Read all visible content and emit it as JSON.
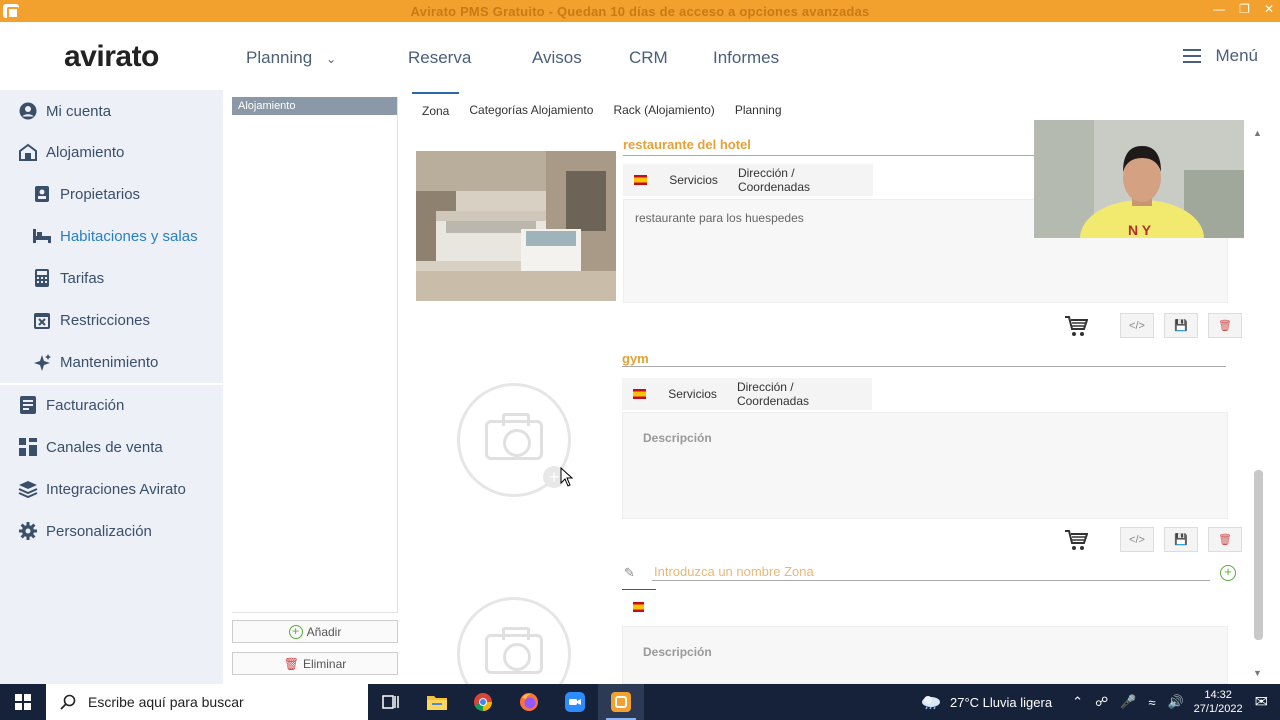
{
  "window": {
    "title": "Avirato PMS Gratuito - Quedan 10 días de acceso a opciones avanzadas"
  },
  "nav": {
    "logo": "avirato",
    "items": [
      "Planning",
      "Reserva",
      "Avisos",
      "CRM",
      "Informes"
    ],
    "menu_label": "Menú"
  },
  "sidebar": {
    "items": [
      {
        "label": "Mi cuenta",
        "icon": "user-icon"
      },
      {
        "label": "Alojamiento",
        "icon": "building-icon"
      },
      {
        "label": "Propietarios",
        "icon": "id-card-icon"
      },
      {
        "label": "Habitaciones y salas",
        "icon": "bed-icon",
        "active": true
      },
      {
        "label": "Tarifas",
        "icon": "calculator-icon"
      },
      {
        "label": "Restricciones",
        "icon": "calendar-x-icon"
      },
      {
        "label": "Mantenimiento",
        "icon": "sparkle-icon"
      },
      {
        "label": "Facturación",
        "icon": "invoice-icon"
      },
      {
        "label": "Canales de venta",
        "icon": "channels-icon"
      },
      {
        "label": "Integraciones Avirato",
        "icon": "layers-icon"
      },
      {
        "label": "Personalización",
        "icon": "gear-icon"
      }
    ]
  },
  "list_panel": {
    "header": "Alojamiento",
    "add_label": "Añadir",
    "delete_label": "Eliminar"
  },
  "tabs": [
    "Zona",
    "Categorías Alojamiento",
    "Rack (Alojamiento)",
    "Planning"
  ],
  "zones": [
    {
      "name": "restaurante del hotel",
      "subtabs": [
        "Servicios",
        "Dirección / Coordenadas"
      ],
      "description": "restaurante para los huespedes"
    },
    {
      "name": "gym",
      "subtabs": [
        "Servicios",
        "Dirección / Coordenadas"
      ],
      "description_placeholder": "Descripción"
    }
  ],
  "new_zone": {
    "placeholder": "Introduzca un nombre Zona",
    "description_placeholder": "Descripción"
  },
  "taskbar": {
    "search_placeholder": "Escribe aquí para buscar",
    "weather": "27°C  Lluvia ligera",
    "time": "14:32",
    "date": "27/1/2022"
  },
  "colors": {
    "accent_orange": "#f2a12e",
    "zone_name": "#e4a236",
    "nav_text": "#4a5f7a",
    "sidebar_bg": "#eef0f8",
    "active_blue": "#2a7fc2"
  }
}
